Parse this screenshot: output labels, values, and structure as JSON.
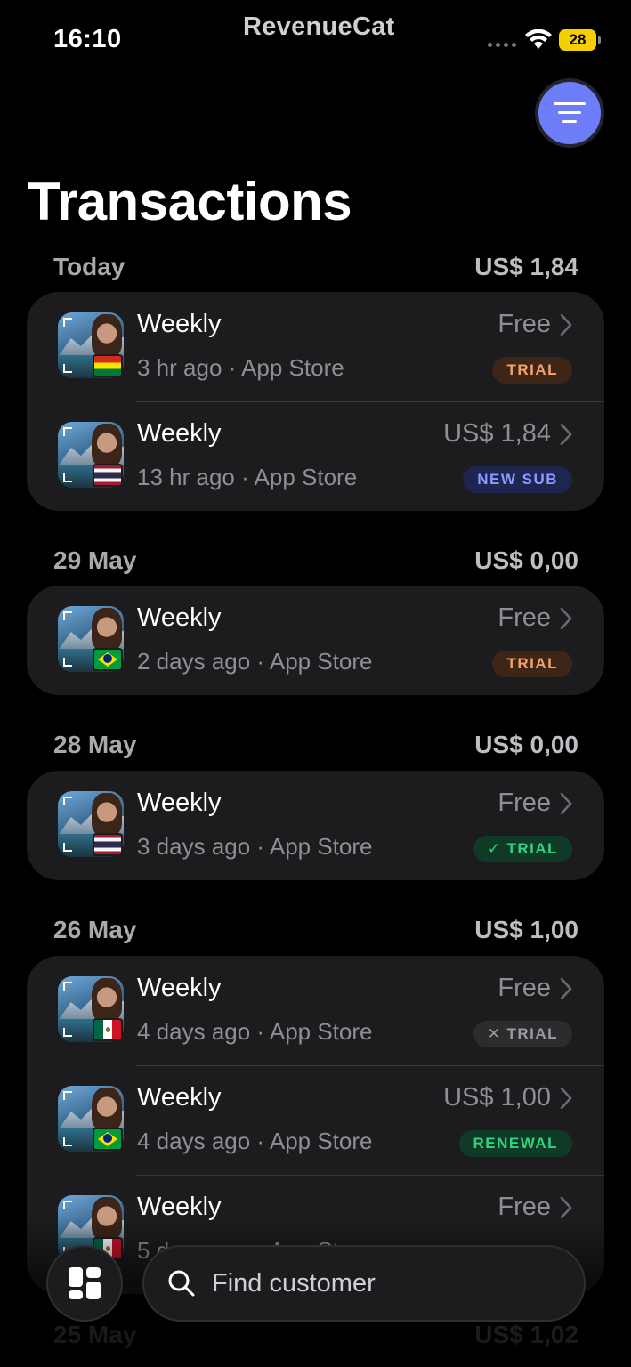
{
  "status_bar": {
    "time": "16:10",
    "brand": "RevenueCat",
    "battery": "28"
  },
  "header": {
    "title": "Transactions"
  },
  "sections": [
    {
      "date": "Today",
      "total": "US$ 1,84",
      "rows": [
        {
          "product": "Weekly",
          "meta": "3 hr ago · App Store",
          "price": "Free",
          "badge": "TRIAL",
          "badge_style": "trial",
          "flag": "bolivia-flag"
        },
        {
          "product": "Weekly",
          "meta": "13 hr ago · App Store",
          "price": "US$ 1,84",
          "badge": "NEW SUB",
          "badge_style": "newsub",
          "flag": "thailand-flag"
        }
      ]
    },
    {
      "date": "29 May",
      "total": "US$ 0,00",
      "rows": [
        {
          "product": "Weekly",
          "meta": "2 days ago · App Store",
          "price": "Free",
          "badge": "TRIAL",
          "badge_style": "trial",
          "flag": "brazil-flag"
        }
      ]
    },
    {
      "date": "28 May",
      "total": "US$ 0,00",
      "rows": [
        {
          "product": "Weekly",
          "meta": "3 days ago · App Store",
          "price": "Free",
          "badge": "TRIAL",
          "badge_prefix": "✓",
          "badge_style": "trial-ok",
          "flag": "thailand-flag"
        }
      ]
    },
    {
      "date": "26 May",
      "total": "US$ 1,00",
      "rows": [
        {
          "product": "Weekly",
          "meta": "4 days ago · App Store",
          "price": "Free",
          "badge": "TRIAL",
          "badge_prefix": "✕",
          "badge_style": "trial-x",
          "flag": "mexico-flag"
        },
        {
          "product": "Weekly",
          "meta": "4 days ago · App Store",
          "price": "US$ 1,00",
          "badge": "RENEWAL",
          "badge_style": "renewal",
          "flag": "brazil-flag"
        },
        {
          "product": "Weekly",
          "meta": "5 days ago · App Store",
          "price": "Free",
          "flag": "mexico-flag"
        }
      ]
    },
    {
      "date": "25 May",
      "total": "US$ 1,02"
    }
  ],
  "bottom_bar": {
    "search_placeholder": "Find customer"
  },
  "colors": {
    "accent": "#6e7ef8",
    "card_bg": "#1c1c1e",
    "trial": "#f5a26a",
    "new_sub": "#8a9bff",
    "renewal": "#33d37e"
  }
}
